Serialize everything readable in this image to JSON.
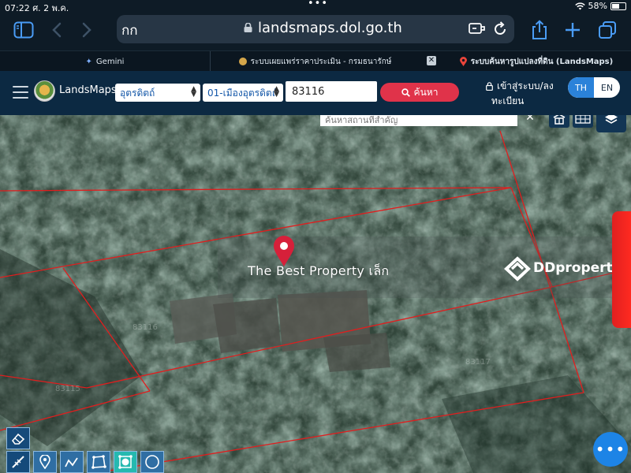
{
  "status_bar": {
    "time": "07:22",
    "date": "ศ. 2 พ.ค.",
    "battery": "58%"
  },
  "browser": {
    "aa_label": "กก",
    "url": "landsmaps.dol.go.th",
    "tabs": [
      {
        "label": "Gemini",
        "icon": "gemini-sparkle-icon"
      },
      {
        "label": "ระบบเผยแพร่ราคาประเมิน - กรมธนารักษ์",
        "icon": "treasury-logo-icon"
      },
      {
        "label": "ระบบค้นหารูปแปลงที่ดิน (LandsMaps)",
        "icon": "map-pin-icon"
      }
    ],
    "tab_close_label": "✕"
  },
  "header": {
    "brand": "LandsMaps",
    "province": "อุตรดิตถ์",
    "district": "01-เมืองอุตรดิตถ์",
    "parcel_number": "83116",
    "search_label": "ค้นหา",
    "login_line1": "เข้าสู่ระบบ/ลง",
    "login_line2": "ทะเบียน",
    "lang_th": "TH",
    "lang_en": "EN"
  },
  "map": {
    "place_search_placeholder": "ค้นหาสถานที่สำคัญ",
    "close_label": "✕",
    "overlay_text": "The Best Property เล็ก",
    "brand_watermark": "DDproperty",
    "more_label": "•••"
  },
  "colors": {
    "header_bg": "#0c2942",
    "search_button": "#e0334a",
    "lang_active": "#2b82d9",
    "parcel_line": "#e01e1e",
    "fab": "#1d84e6"
  }
}
